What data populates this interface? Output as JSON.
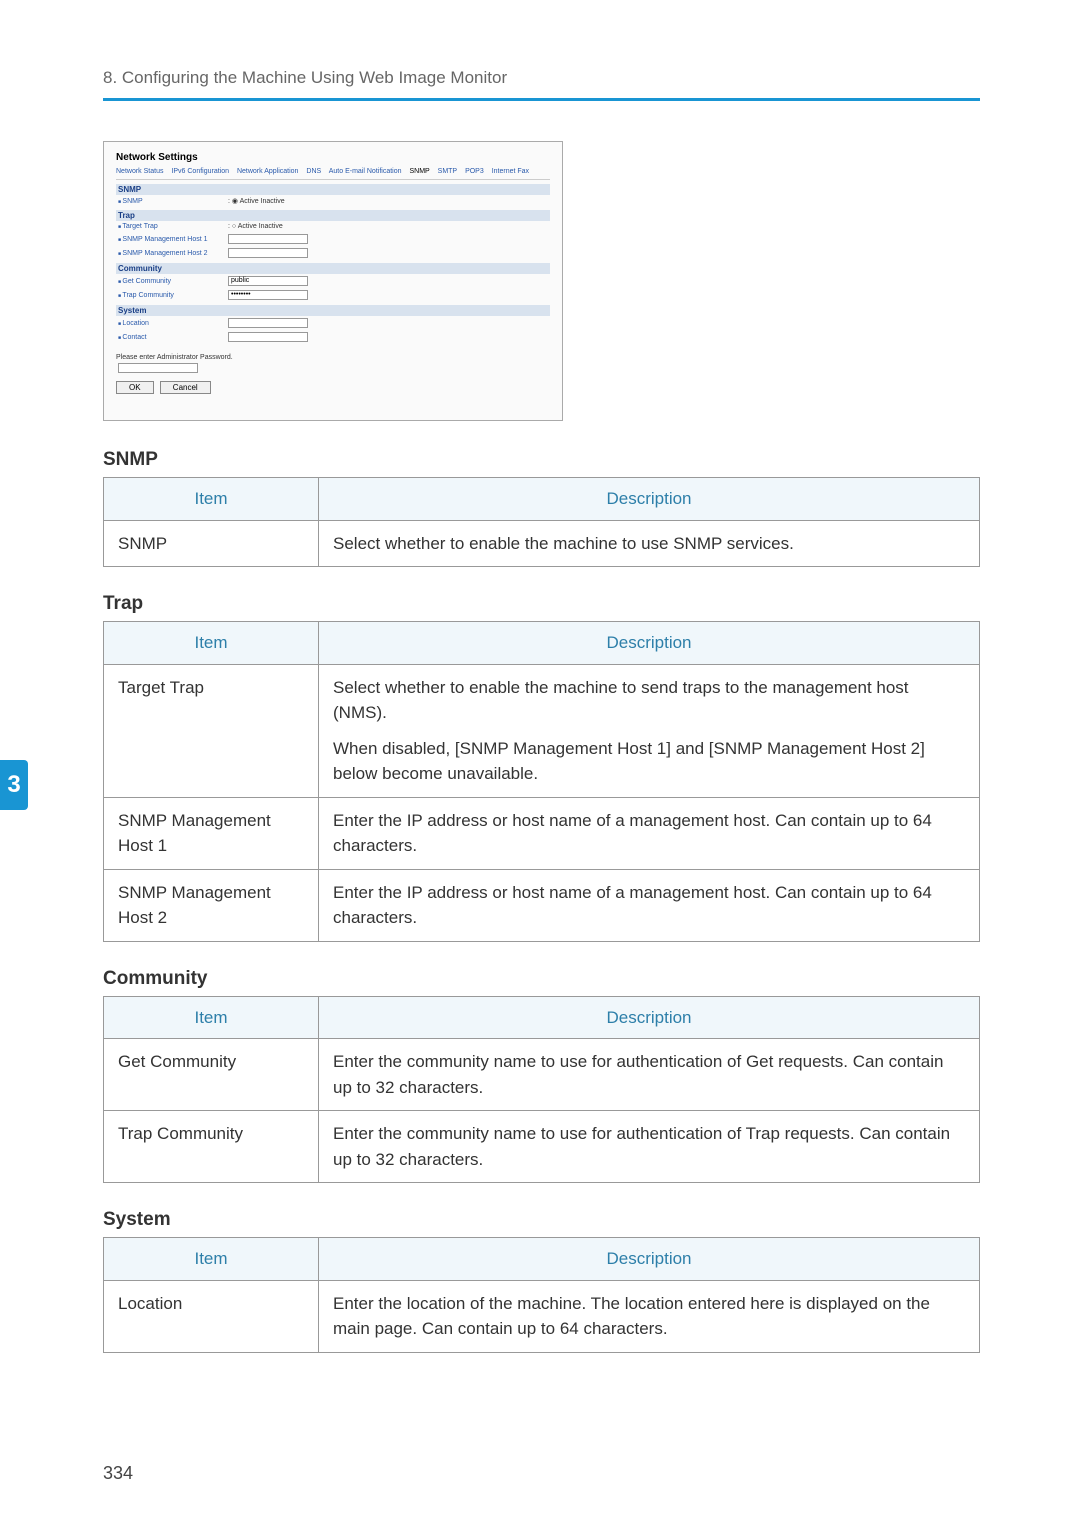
{
  "header": {
    "chapter_label": "8. Configuring the Machine Using Web Image Monitor",
    "tab_number": "3"
  },
  "screenshot": {
    "title": "Network Settings",
    "tabs": [
      "Network Status",
      "IPv6 Configuration",
      "Network Application",
      "DNS",
      "Auto E-mail Notification",
      "SNMP",
      "SMTP",
      "POP3",
      "Internet Fax"
    ],
    "snmp_section": "SNMP",
    "snmp_row": {
      "label": "SNMP",
      "value": "Active  Inactive"
    },
    "trap_section": "Trap",
    "trap_rows": [
      {
        "label": "Target Trap",
        "value": "Active  Inactive"
      },
      {
        "label": "SNMP Management Host 1"
      },
      {
        "label": "SNMP Management Host 2"
      }
    ],
    "community_section": "Community",
    "community_rows": [
      {
        "label": "Get Community",
        "value": "public"
      },
      {
        "label": "Trap Community",
        "value": "••••••••"
      }
    ],
    "system_section": "System",
    "system_rows": [
      {
        "label": "Location"
      },
      {
        "label": "Contact"
      }
    ],
    "footer": "Please enter Administrator Password.",
    "ok": "OK",
    "cancel": "Cancel"
  },
  "sections": {
    "snmp": {
      "heading": "SNMP",
      "col_item": "Item",
      "col_desc": "Description",
      "rows": [
        {
          "item": "SNMP",
          "desc": "Select whether to enable the machine to use SNMP services."
        }
      ]
    },
    "trap": {
      "heading": "Trap",
      "col_item": "Item",
      "col_desc": "Description",
      "rows": [
        {
          "item": "Target Trap",
          "desc1": "Select whether to enable the machine to send traps to the management host (NMS).",
          "desc2": "When disabled, [SNMP Management Host 1] and [SNMP Management Host 2] below become unavailable."
        },
        {
          "item": "SNMP Management Host 1",
          "desc1": "Enter the IP address or host name of a management host. Can contain up to 64 characters."
        },
        {
          "item": "SNMP Management Host 2",
          "desc1": "Enter the IP address or host name of a management host. Can contain up to 64 characters."
        }
      ]
    },
    "community": {
      "heading": "Community",
      "col_item": "Item",
      "col_desc": "Description",
      "rows": [
        {
          "item": "Get Community",
          "desc": "Enter the community name to use for authentication of Get requests. Can contain up to 32 characters."
        },
        {
          "item": "Trap Community",
          "desc": "Enter the community name to use for authentication of Trap requests. Can contain up to 32 characters."
        }
      ]
    },
    "system": {
      "heading": "System",
      "col_item": "Item",
      "col_desc": "Description",
      "rows": [
        {
          "item": "Location",
          "desc": "Enter the location of the machine. The location entered here is displayed on the main page. Can contain up to 64 characters."
        }
      ]
    }
  },
  "page_number": "334"
}
